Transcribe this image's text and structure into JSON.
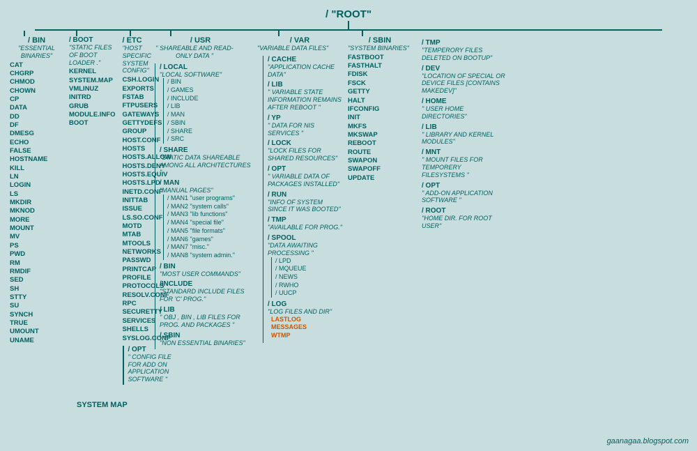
{
  "page": {
    "title": "/ \"ROOT\"",
    "background": "#c8dede",
    "watermark": "gaanagaa.blogspot.com"
  },
  "sections": {
    "bin": {
      "header": "/ BIN",
      "desc": "\"ESSENTIAL BINARIES\"",
      "files": [
        "CAT",
        "CHGRP",
        "CHMOD",
        "CHOWN",
        "CP",
        "DATA",
        "DD",
        "DF",
        "DMESG",
        "ECHO",
        "FALSE",
        "HOSTNAME",
        "KILL",
        "LN",
        "LOGIN",
        "LS",
        "MKDIR",
        "MKNOD",
        "MORE",
        "MOUNT",
        "MV",
        "PS",
        "PWD",
        "RM",
        "RMDIF",
        "SED",
        "SH",
        "STTY",
        "SU",
        "SYNCH",
        "TRUE",
        "UMOUNT",
        "UNAME"
      ]
    },
    "etc": {
      "header": "/ ETC",
      "desc": "\"HOST SPECIFIC SYSTEM CONFIG\"",
      "files": [
        "CSH.LOGIN",
        "EXPORTS",
        "FSTAB",
        "FTPUSERS",
        "GATEWAYS",
        "GETTYDEFS",
        "GROUP",
        "HOST.CONF",
        "HOSTS",
        "HOSTS.ALLOW",
        "HOSTS.DENY",
        "HOSTS.EQUIV",
        "HOSTS.LPD",
        "INETD.CONF",
        "INITTAB",
        "ISSUE",
        "LS.SO.CONF",
        "MOTD",
        "MTAB",
        "MTOOLS",
        "NETWORKS",
        "PASSWD",
        "PRINTCAP",
        "PROFILE",
        "PROTOCOLS",
        "RESOLV.CONF",
        "RPC",
        "SECURETTY",
        "SERVICES",
        "SHELLS",
        "SYSLOG.CONF"
      ],
      "opt": {
        "header": "/ OPT",
        "desc": "\" CONFIG FILE FOR ADD ON APPLICATION SOFTWARE \""
      }
    },
    "boot": {
      "header": "/ BOOT",
      "desc": "\"STATIC FILES OF BOOT LOADER .\"",
      "files": [
        "KERNEL",
        "SYSTEM.MAP",
        "VMLINUZ",
        "INITRD",
        "GRUB",
        "MODULE.INFO",
        "BOOT"
      ]
    },
    "usr": {
      "header": "/ USR",
      "desc": "\" SHAREABLE AND READ-ONLY DATA \"",
      "local": {
        "header": "/ LOCAL",
        "desc": "\"LOCAL SOFTWARE\"",
        "subdirs": [
          "/ BIN",
          "/ GAMES",
          "/ INCLUDE",
          "/ LIB",
          "/ MAN",
          "/ SBIN",
          "/ SHARE",
          "/ SRC"
        ]
      },
      "share": {
        "header": "/ SHARE",
        "desc": "\"STATIC DATA SHAREABLE AMONG ALL ARCHITECTURES \""
      },
      "man": {
        "header": "/ MAN",
        "desc": "\"MANUAL PAGES\"",
        "subdirs": [
          "/ MAN1 \"user programs\"",
          "/ MAN2 \"system calls\"",
          "/ MAN3 \"lib functions\"",
          "/ MAN4 \"special file\"",
          "/ MAN5 \"file formats\"",
          "/ MAN6 \"games\"",
          "/ MAN7 \"misc.\"",
          "/ MAN8 \"system admin.\""
        ]
      },
      "bin": {
        "header": "/ BIN",
        "desc": "\"MOST USER COMMANDS\""
      },
      "include": {
        "header": "/ INCLUDE",
        "desc": "\"STANDARD INCLUDE FILES FOR 'C' PROG.\""
      },
      "lib": {
        "header": "/ LIB",
        "desc": "\" OBJ , BIN , LIB FILES FOR PROG. AND PACKAGES \""
      },
      "sbin": {
        "header": "/ SBIN",
        "desc": "\"NON ESSENTIAL BINARIES\""
      }
    },
    "var": {
      "header": "/ VAR",
      "desc": "\"VARIABLE DATA FILES\"",
      "cache": {
        "header": "/ CACHE",
        "desc": "\"APPLICATION CACHE DATA\""
      },
      "lib": {
        "header": "/ LIB",
        "desc": "\" VARIABLE STATE INFORMATION REMAINS AFTER REBOOT \""
      },
      "yp": {
        "header": "/ YP",
        "desc": "\" DATA FOR NIS SERVICES \""
      },
      "lock": {
        "header": "/ LOCK",
        "desc": "\"LOCK FILES FOR SHARED RESOURCES\""
      },
      "opt": {
        "header": "/ OPT",
        "desc": "\" VARIABLE DATA OF PACKAGES INSTALLED\""
      },
      "run": {
        "header": "/ RUN",
        "desc": "\"INFO OF SYSTEM SINCE IT WAS BOOTED\""
      },
      "tmp": {
        "header": "/ TMP",
        "desc": "\"AVAILABLE FOR PROG.\""
      },
      "spool": {
        "header": "/ SPOOL",
        "desc": "\"DATA AWAITING PROCESSING \"",
        "subdirs": [
          "/ LPD",
          "/ MQUEUE",
          "/ NEWS",
          "/ RWHO",
          "/ UUCP"
        ]
      },
      "log": {
        "header": "/ LOG",
        "desc": "\"LOG FILES AND DIR\"",
        "files_orange": [
          "LASTLOG",
          "MESSAGES",
          "WTMP"
        ]
      }
    },
    "sbin": {
      "header": "/ SBIN",
      "desc": "\"SYSTEM BINARIES\"",
      "files_orange": [
        "FASTBOOT",
        "FASTHALT",
        "FDISK",
        "FSCK",
        "GETTY",
        "HALT",
        "IFCONFIG",
        "INIT",
        "MKFS",
        "MKSWAP",
        "REBOOT",
        "ROUTE",
        "SWAPON",
        "SWAPOFF",
        "UPDATE"
      ]
    },
    "right": {
      "tmp": {
        "header": "/ TMP",
        "desc": "\"TEMPERORY FILES DELETED ON BOOTUP\""
      },
      "dev": {
        "header": "/ DEV",
        "desc": "\"LOCATION OF SPECIAL OR DEVICE FILES [CONTAINS MAKEDEV]\""
      },
      "home": {
        "header": "/ HOME",
        "desc": "\" USER HOME DIRECTORIES\""
      },
      "lib": {
        "header": "/ LIB",
        "desc": "\"  LIBRARY AND KERNEL MODULES\""
      },
      "mnt": {
        "header": "/ MNT",
        "desc": "\"  MOUNT FILES FOR TEMPORERY FILESYSTEMS \""
      },
      "opt": {
        "header": "/ OPT",
        "desc": "\" ADD-ON APPLICATION SOFTWARE \""
      },
      "root": {
        "header": "/ ROOT",
        "desc": "\"HOME DIR. FOR ROOT USER\""
      }
    }
  }
}
